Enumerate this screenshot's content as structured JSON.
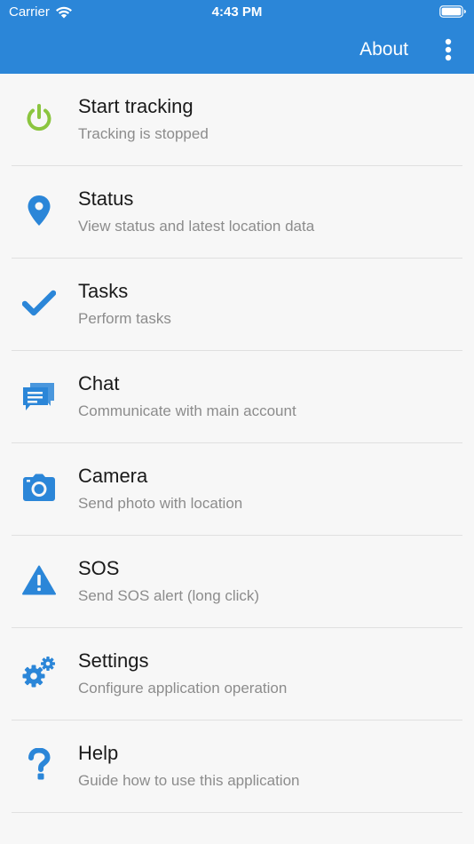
{
  "status_bar": {
    "carrier": "Carrier",
    "time": "4:43 PM"
  },
  "toolbar": {
    "about_label": "About"
  },
  "colors": {
    "primary": "#2b86d8",
    "power_icon": "#8bc53f",
    "icon_blue": "#2b86d8"
  },
  "menu": [
    {
      "title": "Start tracking",
      "subtitle": "Tracking is stopped",
      "icon": "power-icon"
    },
    {
      "title": "Status",
      "subtitle": "View status and latest location data",
      "icon": "location-pin-icon"
    },
    {
      "title": "Tasks",
      "subtitle": "Perform tasks",
      "icon": "checkmark-icon"
    },
    {
      "title": "Chat",
      "subtitle": "Communicate with main account",
      "icon": "chat-icon"
    },
    {
      "title": "Camera",
      "subtitle": "Send photo with location",
      "icon": "camera-icon"
    },
    {
      "title": "SOS",
      "subtitle": "Send SOS alert (long click)",
      "icon": "warning-icon"
    },
    {
      "title": "Settings",
      "subtitle": "Configure application operation",
      "icon": "gears-icon"
    },
    {
      "title": "Help",
      "subtitle": "Guide how to use this application",
      "icon": "question-icon"
    }
  ]
}
